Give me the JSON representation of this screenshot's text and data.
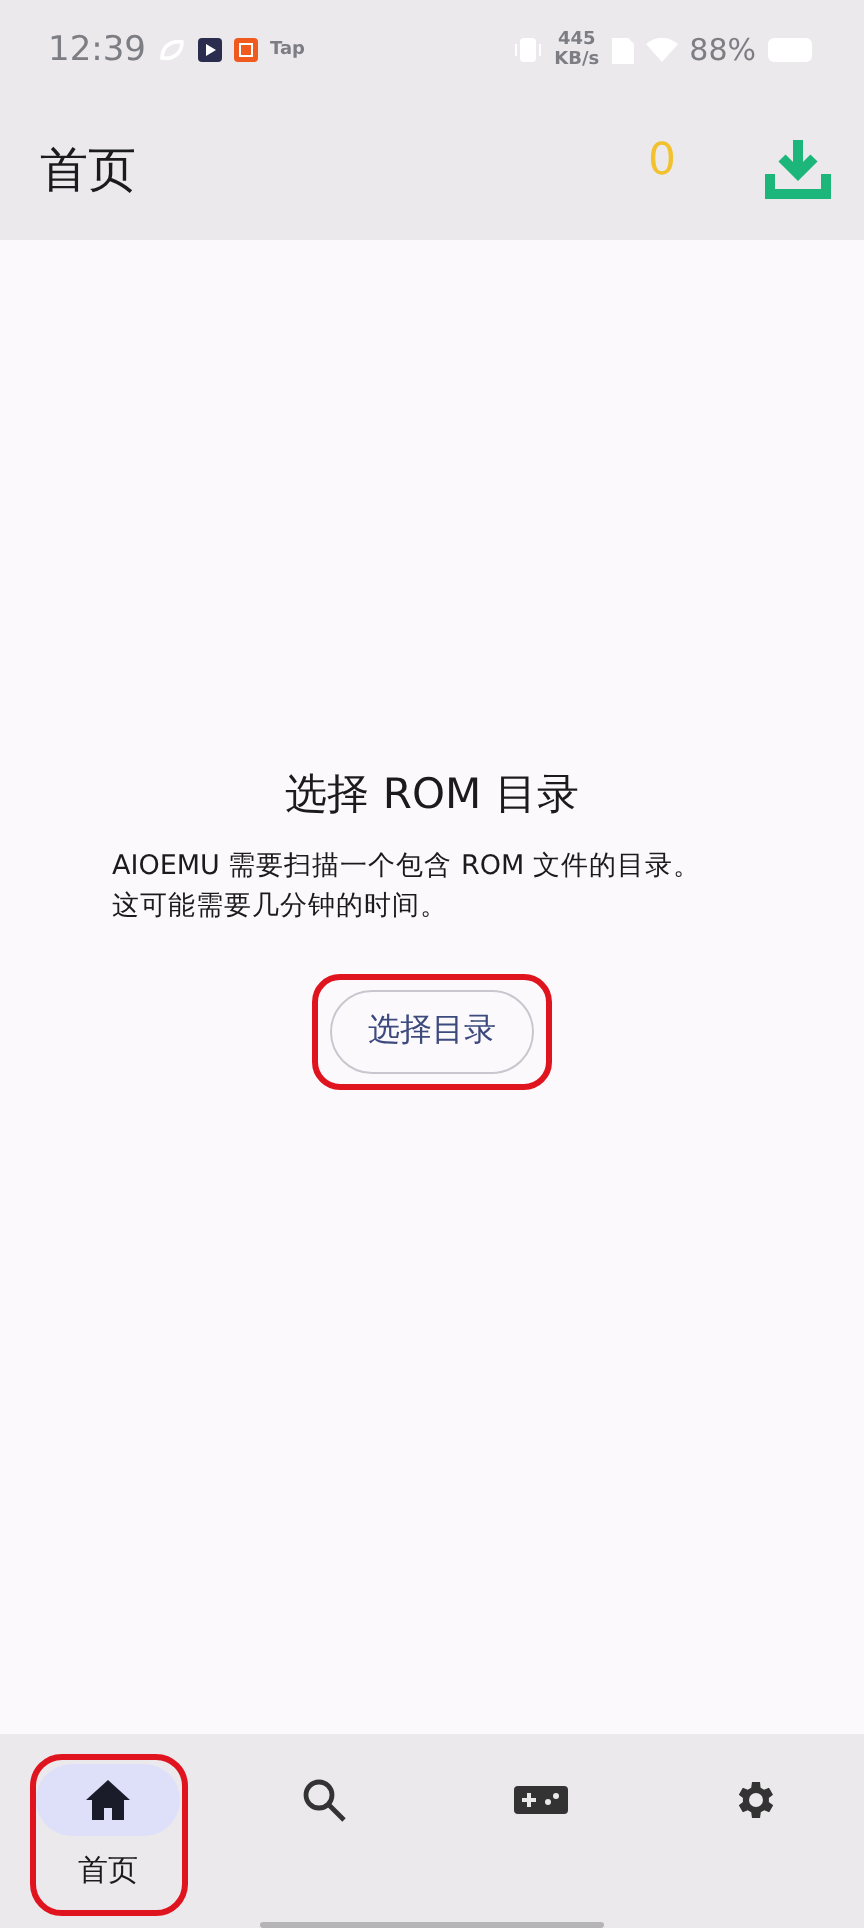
{
  "status_bar": {
    "time": "12:39",
    "app_label": "Tap",
    "net_speed": [
      "445",
      "KB/s"
    ],
    "battery": "88%"
  },
  "header": {
    "title": "首页",
    "count": "0"
  },
  "empty_state": {
    "title": "选择 ROM 目录",
    "message": [
      "AIOEMU 需要扫描一个包含 ROM 文件的目录。",
      "这可能需要几分钟的时间。"
    ],
    "button": {
      "label": "选择目录",
      "highlighted": true
    }
  },
  "nav": [
    {
      "kind": "home",
      "label": "首页",
      "selected": true,
      "highlighted": true
    },
    {
      "kind": "search",
      "selected": false,
      "highlighted": false
    },
    {
      "kind": "games",
      "selected": false,
      "highlighted": false
    },
    {
      "kind": "settings",
      "selected": false,
      "highlighted": false
    }
  ]
}
